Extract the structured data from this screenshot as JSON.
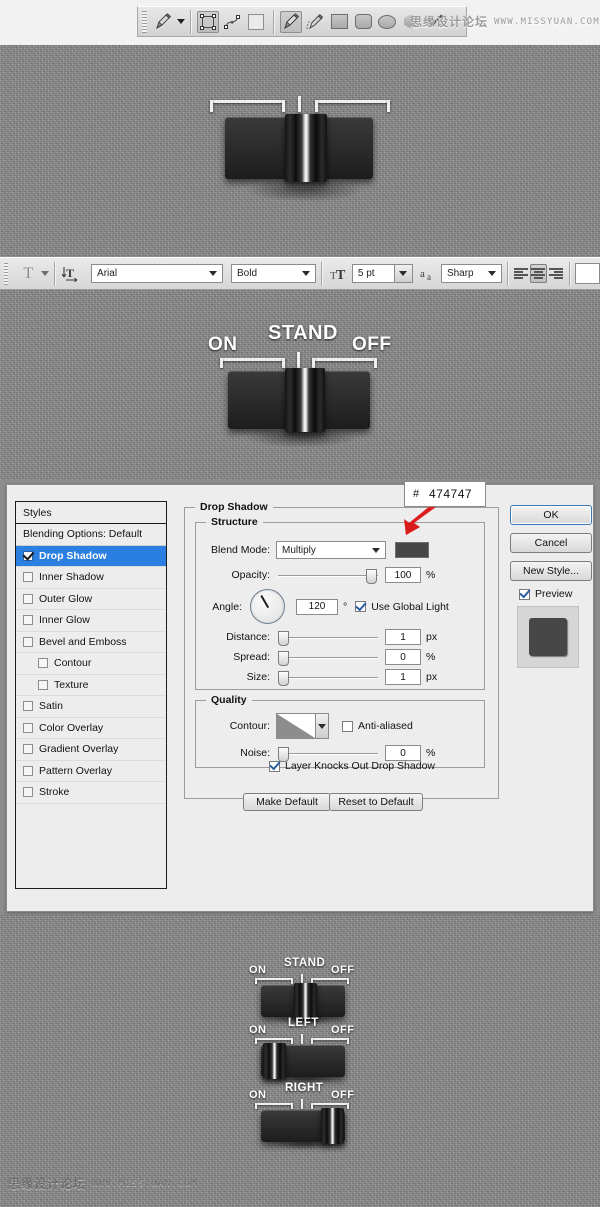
{
  "toolbar_pen": {
    "tools": [
      {
        "name": "pen-tool",
        "icon": "pen-icon"
      },
      {
        "name": "tool-preset-caret",
        "icon": "caret-down-icon"
      },
      {
        "name": "shape-layers",
        "icon": "shape-layers-icon"
      },
      {
        "name": "paths",
        "icon": "paths-icon"
      },
      {
        "name": "fill-pixels",
        "icon": "fill-pixels-icon"
      },
      {
        "name": "pen-mode",
        "icon": "pen-icon"
      },
      {
        "name": "freeform-pen",
        "icon": "freeform-pen-icon"
      },
      {
        "name": "rectangle-tool",
        "icon": "rectangle-icon"
      },
      {
        "name": "rounded-rectangle-tool",
        "icon": "rounded-rectangle-icon"
      },
      {
        "name": "ellipse-tool",
        "icon": "ellipse-icon"
      },
      {
        "name": "polygon-tool",
        "icon": "polygon-icon"
      },
      {
        "name": "line-tool",
        "icon": "line-icon"
      }
    ]
  },
  "watermark": {
    "cn": "思缘设计论坛",
    "url": "WWW.MISSYUAN.COM"
  },
  "toolbar_text": {
    "tool_icon_label": "T",
    "orientation_label": "text-orientation",
    "font_family": "Arial",
    "font_style": "Bold",
    "font_size": "5 pt",
    "anti_alias": "Sharp",
    "align": [
      "align-left",
      "align-center",
      "align-right"
    ],
    "align_selected": 1,
    "color": "#ffffff"
  },
  "scenes": {
    "scene1": {
      "switch": {
        "labels": [],
        "knob_position": "center"
      }
    },
    "scene2": {
      "switch": {
        "label_left": "ON",
        "label_center": "STAND",
        "label_right": "OFF",
        "knob_position": "center"
      }
    },
    "scene3": {
      "switches": [
        {
          "label_left": "ON",
          "label_center": "STAND",
          "label_right": "OFF",
          "knob_position": "center"
        },
        {
          "label_left": "ON",
          "label_center": "LEFT",
          "label_right": "OFF",
          "knob_position": "left"
        },
        {
          "label_left": "ON",
          "label_center": "RIGHT",
          "label_right": "OFF",
          "knob_position": "right"
        }
      ]
    }
  },
  "dialog": {
    "styles_panel": {
      "header": "Styles",
      "items": [
        {
          "label": "Blending Options: Default",
          "checkbox": false,
          "checked": false,
          "selected": false,
          "sub": false
        },
        {
          "label": "Drop Shadow",
          "checkbox": true,
          "checked": true,
          "selected": true,
          "sub": false
        },
        {
          "label": "Inner Shadow",
          "checkbox": true,
          "checked": false,
          "selected": false,
          "sub": false
        },
        {
          "label": "Outer Glow",
          "checkbox": true,
          "checked": false,
          "selected": false,
          "sub": false
        },
        {
          "label": "Inner Glow",
          "checkbox": true,
          "checked": false,
          "selected": false,
          "sub": false
        },
        {
          "label": "Bevel and Emboss",
          "checkbox": true,
          "checked": false,
          "selected": false,
          "sub": false
        },
        {
          "label": "Contour",
          "checkbox": true,
          "checked": false,
          "selected": false,
          "sub": true
        },
        {
          "label": "Texture",
          "checkbox": true,
          "checked": false,
          "selected": false,
          "sub": true
        },
        {
          "label": "Satin",
          "checkbox": true,
          "checked": false,
          "selected": false,
          "sub": false
        },
        {
          "label": "Color Overlay",
          "checkbox": true,
          "checked": false,
          "selected": false,
          "sub": false
        },
        {
          "label": "Gradient Overlay",
          "checkbox": true,
          "checked": false,
          "selected": false,
          "sub": false
        },
        {
          "label": "Pattern Overlay",
          "checkbox": true,
          "checked": false,
          "selected": false,
          "sub": false
        },
        {
          "label": "Stroke",
          "checkbox": true,
          "checked": false,
          "selected": false,
          "sub": false
        }
      ]
    },
    "section_title": "Drop Shadow",
    "structure": {
      "title": "Structure",
      "blend_mode_label": "Blend Mode:",
      "blend_mode_value": "Multiply",
      "blend_color": "#474747",
      "opacity_label": "Opacity:",
      "opacity_value": "100",
      "opacity_unit": "%",
      "angle_label": "Angle:",
      "angle_value": "120",
      "angle_unit": "°",
      "use_global_light": "Use Global Light",
      "use_global_light_checked": true,
      "distance_label": "Distance:",
      "distance_value": "1",
      "distance_unit": "px",
      "spread_label": "Spread:",
      "spread_value": "0",
      "spread_unit": "%",
      "size_label": "Size:",
      "size_value": "1",
      "size_unit": "px"
    },
    "quality": {
      "title": "Quality",
      "contour_label": "Contour:",
      "anti_aliased_label": "Anti-aliased",
      "anti_aliased_checked": false,
      "noise_label": "Noise:",
      "noise_value": "0",
      "noise_unit": "%"
    },
    "knockout_label": "Layer Knocks Out Drop Shadow",
    "knockout_checked": true,
    "make_default": "Make Default",
    "reset_default": "Reset to Default",
    "ok": "OK",
    "cancel": "Cancel",
    "new_style": "New Style...",
    "preview_label": "Preview",
    "preview_checked": true
  },
  "hex_callout": {
    "hash": "#",
    "value": "474747"
  }
}
